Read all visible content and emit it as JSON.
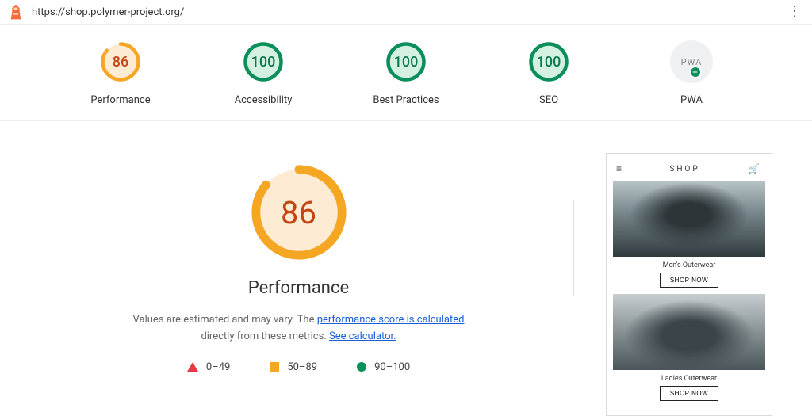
{
  "header": {
    "url": "https://shop.polymer-project.org/"
  },
  "gauges": [
    {
      "key": "performance",
      "label": "Performance",
      "score": 86,
      "color": "#f5a623",
      "bg": "#fdecd3"
    },
    {
      "key": "accessibility",
      "label": "Accessibility",
      "score": 100,
      "color": "#0a8f5b",
      "bg": "#d3f0e1"
    },
    {
      "key": "best-practices",
      "label": "Best Practices",
      "score": 100,
      "color": "#0a8f5b",
      "bg": "#d3f0e1"
    },
    {
      "key": "seo",
      "label": "SEO",
      "score": 100,
      "color": "#0a8f5b",
      "bg": "#d3f0e1"
    }
  ],
  "pwa": {
    "label": "PWA",
    "text": "PWA"
  },
  "detail": {
    "score": 86,
    "title": "Performance",
    "desc_prefix": "Values are estimated and may vary. The ",
    "link1": "performance score is calculated",
    "desc_mid": " directly from these metrics. ",
    "link2": "See calculator."
  },
  "legend": {
    "fail": "0–49",
    "avg": "50–89",
    "pass": "90–100"
  },
  "preview": {
    "brand": "SHOP",
    "card1_caption": "Men's Outerwear",
    "card1_btn": "SHOP NOW",
    "card2_caption": "Ladies Outerwear",
    "card2_btn": "SHOP NOW"
  }
}
